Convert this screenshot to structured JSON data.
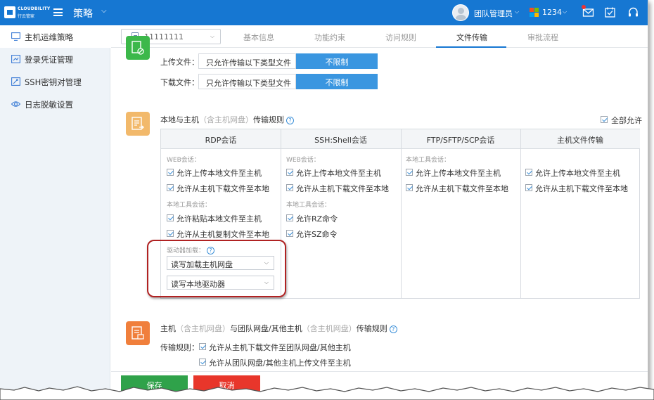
{
  "topbar": {
    "logo_text": "CLOUDBILITY",
    "logo_sub": "行云管家",
    "title": "策略",
    "user_name": "团队管理员",
    "count": "1234"
  },
  "sidebar": {
    "items": [
      {
        "label": "主机运维策略",
        "active": true
      },
      {
        "label": "登录凭证管理",
        "active": false
      },
      {
        "label": "SSH密钥对管理",
        "active": false
      },
      {
        "label": "日志脱敏设置",
        "active": false
      }
    ]
  },
  "tabs": {
    "select_value": "11111111",
    "items": [
      "基本信息",
      "功能约束",
      "访问规则",
      "文件传输",
      "审批流程"
    ],
    "active": "文件传输"
  },
  "upload": {
    "upload_label": "上传文件：",
    "upload_value": "只允许传输以下类型文件",
    "upload_btn": "不限制",
    "download_label": "下载文件：",
    "download_value": "只允许传输以下类型文件",
    "download_btn": "不限制"
  },
  "local_rules": {
    "title_a": "本地与主机",
    "title_b": "（含主机网盘）",
    "title_c": "传输规则",
    "allow_all": "全部允许",
    "columns": [
      "RDP会话",
      "SSH:Shell会话",
      "FTP/SFTP/SCP会话",
      "主机文件传输"
    ],
    "rdp": {
      "web_header": "WEB会话：",
      "web_opts": [
        "允许上传本地文件至主机",
        "允许从主机下载文件至本地"
      ],
      "local_header": "本地工具会话：",
      "local_opts": [
        "允许粘贴本地文件至主机",
        "允许从主机复制文件至本地"
      ],
      "drive_header": "驱动器加载：",
      "drive_selects": [
        "读写加载主机网盘",
        "读写本地驱动器"
      ]
    },
    "ssh": {
      "web_header": "WEB会话：",
      "web_opts": [
        "允许上传本地文件至主机",
        "允许从主机下载文件至本地"
      ],
      "local_header": "本地工具会话：",
      "local_opts": [
        "允许RZ命令",
        "允许SZ命令"
      ]
    },
    "ftp": {
      "local_header": "本地工具会话：",
      "local_opts": [
        "允许上传本地文件至主机",
        "允许从主机下载文件至本地"
      ]
    },
    "host": {
      "opts": [
        "允许上传本地文件至主机",
        "允许从主机下载文件至本地"
      ]
    }
  },
  "team_rules": {
    "title_a": "主机",
    "title_b": "（含主机网盘）",
    "title_c": "与团队网盘/其他主机",
    "title_d": "（含主机网盘）",
    "title_e": "传输规则",
    "label": "传输规则：",
    "opts": [
      "允许从主机下载文件至团队网盘/其他主机",
      "允许从团队网盘/其他主机上传文件至主机"
    ]
  },
  "footer": {
    "save": "保存",
    "cancel": "取消"
  }
}
